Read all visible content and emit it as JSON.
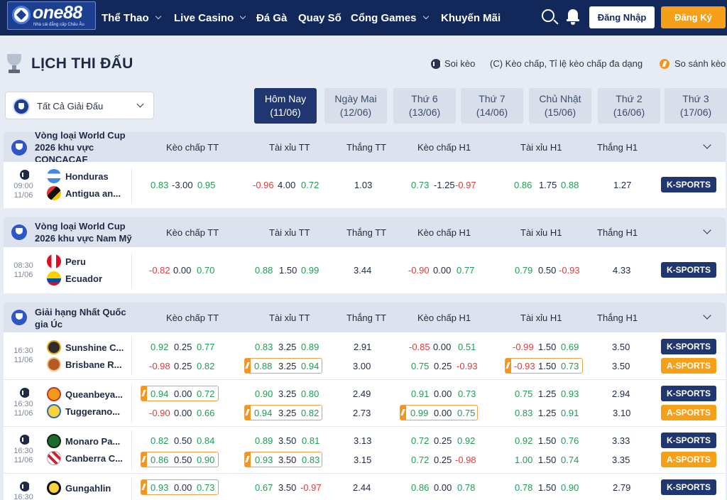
{
  "header": {
    "logo": {
      "name": "one88",
      "tagline": "Nhà cái đẳng cấp Châu Âu"
    },
    "nav": [
      {
        "label": "Thể Thao",
        "dropdown": true
      },
      {
        "label": "Live Casino",
        "dropdown": true
      },
      {
        "label": "Đá Gà",
        "dropdown": false
      },
      {
        "label": "Quay Số",
        "dropdown": false
      },
      {
        "label": "Cổng Games",
        "dropdown": true
      },
      {
        "label": "Khuyến Mãi",
        "dropdown": false
      }
    ],
    "login_label": "Đăng Nhập",
    "register_label": "Đăng Ký"
  },
  "page": {
    "title": "LỊCH THI ĐẤU",
    "legend": {
      "stats": "Soi kèo",
      "handicap": "(C) Kèo chấp, Tỉ lệ kèo chấp đa dạng",
      "compare": "So sánh kèo"
    },
    "league_filter": "Tất Cả Giải Đấu",
    "days": [
      {
        "name": "Hôm Nay",
        "date": "(11/06)",
        "active": true
      },
      {
        "name": "Ngày Mai",
        "date": "(12/06)",
        "active": false
      },
      {
        "name": "Thứ 6",
        "date": "(13/06)",
        "active": false
      },
      {
        "name": "Thứ 7",
        "date": "(14/06)",
        "active": false
      },
      {
        "name": "Chủ Nhật",
        "date": "(15/06)",
        "active": false
      },
      {
        "name": "Thứ 2",
        "date": "(16/06)",
        "active": false
      },
      {
        "name": "Thứ 3",
        "date": "(17/06)",
        "active": false
      }
    ],
    "columns": [
      "Kèo chấp TT",
      "Tài xỉu TT",
      "Thắng TT",
      "Kèo chấp H1",
      "Tài xỉu H1",
      "Thắng H1"
    ]
  },
  "colors": {
    "navy": "#13285a",
    "accent_orange": "#f6a019",
    "odd_positive": "#1f9d55",
    "odd_negative": "#e23b3b"
  },
  "leagues": [
    {
      "name": [
        "Vòng loại World Cup",
        "2026 khu vực",
        "CONCACAF"
      ],
      "matches": [
        {
          "time": "09:00",
          "date": "11/06",
          "stats": true,
          "teams": [
            "Honduras",
            "Antigua an..."
          ],
          "lines": [
            {
              "hcp": [
                "0.83",
                "-3.00",
                "0.95"
              ],
              "ou": [
                "-0.96",
                "4.00",
                "0.72"
              ],
              "win": "1.03",
              "hcp1": [
                "0.73",
                "-1.25",
                "-0.97"
              ],
              "ou1": [
                "0.86",
                "1.75",
                "0.88"
              ],
              "win1": "1.27",
              "sport": "K-SPORTS"
            }
          ]
        }
      ]
    },
    {
      "name": [
        "Vòng loại World Cup",
        "2026 khu vực Nam Mỹ"
      ],
      "matches": [
        {
          "time": "08:30",
          "date": "11/06",
          "stats": false,
          "teams": [
            "Peru",
            "Ecuador"
          ],
          "lines": [
            {
              "hcp": [
                "-0.82",
                "0.00",
                "0.70"
              ],
              "ou": [
                "0.88",
                "1.50",
                "0.99"
              ],
              "win": "3.44",
              "hcp1": [
                "-0.90",
                "0.00",
                "0.77"
              ],
              "ou1": [
                "0.79",
                "0.50",
                "-0.93"
              ],
              "win1": "4.33",
              "sport": "K-SPORTS"
            }
          ]
        }
      ]
    },
    {
      "name": [
        "Giải hạng Nhất Quốc",
        "gia Úc"
      ],
      "matches": [
        {
          "time": "16:30",
          "date": "11/06",
          "stats": false,
          "teams": [
            "Sunshine C...",
            "Brisbane R..."
          ],
          "lines": [
            {
              "hcp": [
                "0.92",
                "0.25",
                "0.77"
              ],
              "ou": [
                "0.83",
                "3.25",
                "0.89"
              ],
              "win": "2.91",
              "hcp1": [
                "-0.85",
                "0.00",
                "0.51"
              ],
              "ou1": [
                "-0.99",
                "1.50",
                "0.69"
              ],
              "win1": "3.50",
              "sport": "K-SPORTS"
            },
            {
              "hcp": [
                "-0.98",
                "0.25",
                "0.82"
              ],
              "ou": [
                "0.88",
                "3.25",
                "0.94"
              ],
              "win": "3.00",
              "hcp1": [
                "0.75",
                "0.25",
                "-0.93"
              ],
              "ou1": [
                "-0.93",
                "1.50",
                "0.73"
              ],
              "win1": "3.50",
              "sport": "A-SPORTS"
            }
          ]
        },
        {
          "time": "16:30",
          "date": "11/06",
          "stats": true,
          "teams": [
            "Queanbeya...",
            "Tuggerano..."
          ],
          "lines": [
            {
              "hcp": [
                "0.94",
                "0.00",
                "0.72"
              ],
              "ou": [
                "0.90",
                "3.25",
                "0.80"
              ],
              "win": "2.49",
              "hcp1": [
                "0.91",
                "0.00",
                "0.73"
              ],
              "ou1": [
                "0.75",
                "1.25",
                "0.93"
              ],
              "win1": "2.94",
              "sport": "K-SPORTS"
            },
            {
              "hcp": [
                "-0.90",
                "0.00",
                "0.66"
              ],
              "ou": [
                "0.94",
                "3.25",
                "0.82"
              ],
              "win": "2.73",
              "hcp1": [
                "0.99",
                "0.00",
                "0.75"
              ],
              "ou1": [
                "0.83",
                "1.25",
                "0.91"
              ],
              "win1": "3.10",
              "sport": "A-SPORTS"
            }
          ]
        },
        {
          "time": "16:30",
          "date": "11/06",
          "stats": true,
          "teams": [
            "Monaro Pa...",
            "Canberra C..."
          ],
          "lines": [
            {
              "hcp": [
                "0.82",
                "0.50",
                "0.84"
              ],
              "ou": [
                "0.89",
                "3.50",
                "0.81"
              ],
              "win": "3.13",
              "hcp1": [
                "0.72",
                "0.25",
                "0.92"
              ],
              "ou1": [
                "0.92",
                "1.50",
                "0.76"
              ],
              "win1": "3.33",
              "sport": "K-SPORTS"
            },
            {
              "hcp": [
                "0.86",
                "0.50",
                "0.90"
              ],
              "ou": [
                "0.93",
                "3.50",
                "0.83"
              ],
              "win": "3.15",
              "hcp1": [
                "0.72",
                "0.25",
                "-0.98"
              ],
              "ou1": [
                "1.00",
                "1.50",
                "0.74"
              ],
              "win1": "3.35",
              "sport": "A-SPORTS"
            }
          ]
        },
        {
          "time": "16:30",
          "date": "",
          "stats": true,
          "teams": [
            "Gungahlin"
          ],
          "lines": [
            {
              "hcp": [
                "0.93",
                "0.00",
                "0.73"
              ],
              "ou": [
                "0.67",
                "3.50",
                "-0.97"
              ],
              "win": "2.44",
              "hcp1": [
                "0.86",
                "0.00",
                "0.78"
              ],
              "ou1": [
                "0.78",
                "1.50",
                "0.90"
              ],
              "win1": "2.79",
              "sport": "K-SPORTS"
            }
          ]
        }
      ]
    }
  ]
}
